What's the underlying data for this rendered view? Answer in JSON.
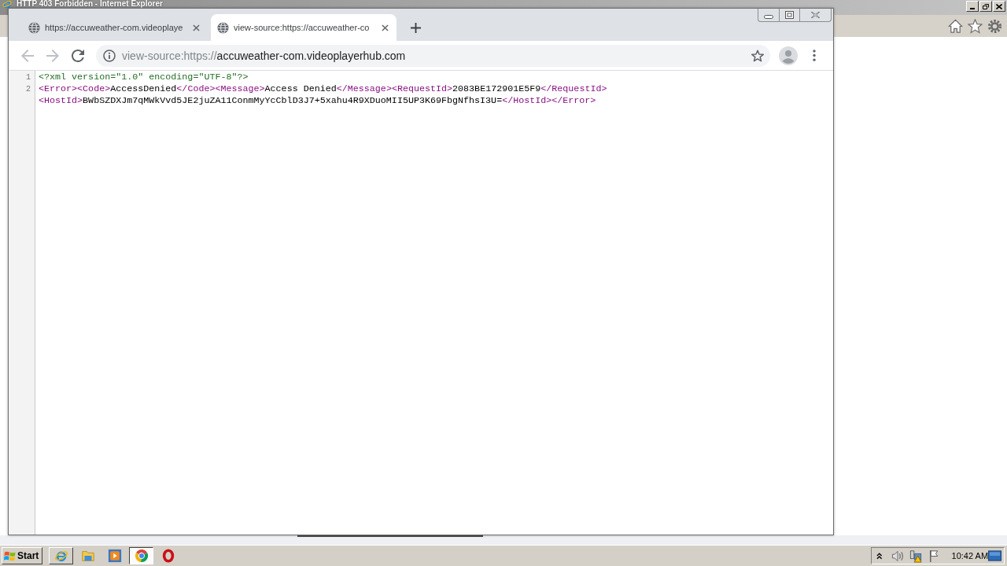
{
  "background_window": {
    "title": "HTTP 403 Forbidden - Internet Explorer"
  },
  "browser": {
    "tabs": [
      {
        "title": "https://accuweather-com.videoplaye",
        "selected": false
      },
      {
        "title": "view-source:https://accuweather-co",
        "selected": true
      }
    ],
    "back": {
      "disabled": true
    },
    "forward": {
      "disabled": true
    },
    "address_bar": {
      "prefix": "view-source:https://",
      "host": "accuweather-com.videoplayerhub.com"
    },
    "source": {
      "lines": [
        {
          "number": "1",
          "rows": [
            {
              "segments": [
                {
                  "kind": "pi",
                  "text": "<?xml version=\"1.0\" encoding=\"UTF-8\"?>"
                }
              ]
            }
          ]
        },
        {
          "number": "2",
          "rows": [
            {
              "segments": [
                {
                  "kind": "tag",
                  "text": "<Error><Code>"
                },
                {
                  "kind": "text",
                  "text": "AccessDenied"
                },
                {
                  "kind": "tag",
                  "text": "</Code><Message>"
                },
                {
                  "kind": "text",
                  "text": "Access Denied"
                },
                {
                  "kind": "tag",
                  "text": "</Message><RequestId>"
                },
                {
                  "kind": "text",
                  "text": "2083BE172901E5F9"
                },
                {
                  "kind": "tag",
                  "text": "</RequestId>"
                }
              ]
            },
            {
              "segments": [
                {
                  "kind": "tag",
                  "text": "<HostId>"
                },
                {
                  "kind": "text",
                  "text": "BWbSZDXJm7qMWkVvd5JE2juZA11ConmMyYcCblD3J7+5xahu4R9XDuoMII5UP3K69FbgNfhsI3U="
                },
                {
                  "kind": "tag",
                  "text": "</HostId></Error>"
                }
              ]
            }
          ]
        }
      ]
    }
  },
  "taskbar": {
    "start_label": "Start",
    "items": [
      {
        "kind": "e-logo",
        "running": true,
        "selected": false
      },
      {
        "kind": "folder",
        "running": false,
        "selected": false
      },
      {
        "kind": "play",
        "running": false,
        "selected": false
      },
      {
        "kind": "round-logo",
        "running": true,
        "selected": true
      },
      {
        "kind": "ring",
        "running": false,
        "selected": false
      }
    ],
    "clock": "10:42 AM"
  }
}
